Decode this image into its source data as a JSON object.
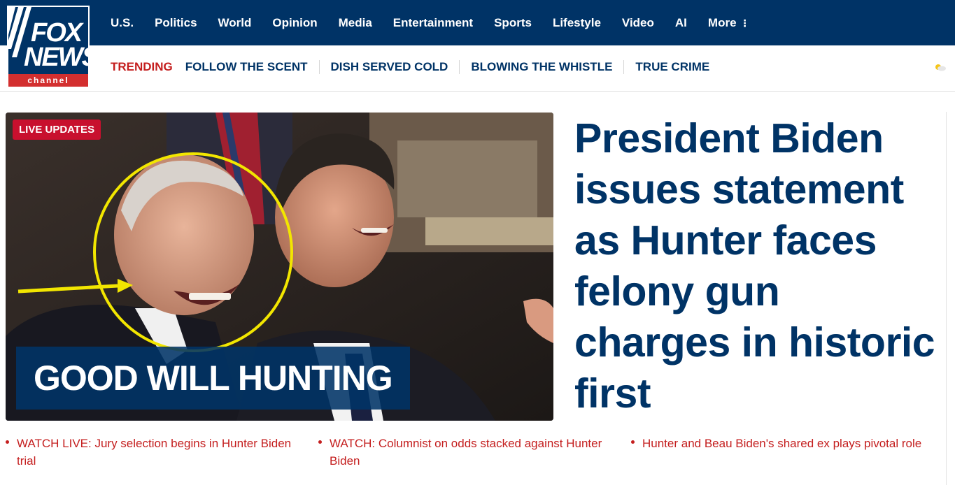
{
  "brand": {
    "logo_top": "FOX",
    "logo_middle": "NEWS",
    "logo_bottom": "channel",
    "primary_color": "#003366",
    "accent_color": "#c41e1e"
  },
  "nav": {
    "items": [
      "U.S.",
      "Politics",
      "World",
      "Opinion",
      "Media",
      "Entertainment",
      "Sports",
      "Lifestyle",
      "Video",
      "AI"
    ],
    "more_label": "More",
    "more_icon": "⋮"
  },
  "trending": {
    "label": "TRENDING",
    "items": [
      "FOLLOW THE SCENT",
      "DISH SERVED COLD",
      "BLOWING THE WHISTLE",
      "TRUE CRIME"
    ],
    "weather_icon": "partly-cloudy-icon"
  },
  "hero": {
    "badge": "LIVE UPDATES",
    "caption": "GOOD WILL HUNTING"
  },
  "headline": "President Biden issues statement as Hunter faces felony gun charges in historic first",
  "related": [
    "WATCH LIVE: Jury selection begins in Hunter Biden trial",
    "WATCH: Columnist on odds stacked against Hunter Biden",
    "Hunter and Beau Biden's shared ex plays pivotal role"
  ]
}
